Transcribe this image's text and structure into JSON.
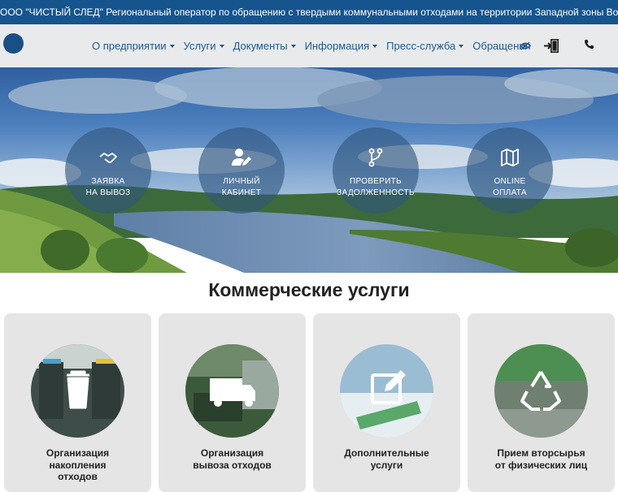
{
  "header": {
    "banner_text": "ООО \"ЧИСТЫЙ СЛЕД\" Региональный оператор по обращению с твердыми коммунальными отходами на территории Западной зоны Вологодской области"
  },
  "nav": {
    "items": [
      {
        "label": "О предприятии",
        "dropdown": true
      },
      {
        "label": "Услуги",
        "dropdown": true
      },
      {
        "label": "Документы",
        "dropdown": true
      },
      {
        "label": "Информация",
        "dropdown": true
      },
      {
        "label": "Пресс-служба",
        "dropdown": true
      },
      {
        "label": "Обращения",
        "dropdown": false
      }
    ],
    "icons": [
      "eye-icon",
      "login-icon",
      "phone-icon"
    ]
  },
  "hero": {
    "buttons": [
      {
        "line1": "ЗАЯВКА",
        "line2": "НА ВЫВОЗ",
        "icon": "handshake-icon"
      },
      {
        "line1": "ЛИЧНЫЙ",
        "line2": "КАБИНЕТ",
        "icon": "user-edit-icon"
      },
      {
        "line1": "ПРОВЕРИТЬ",
        "line2": "ЗАДОЛЖЕННОСТЬ",
        "icon": "branch-icon"
      },
      {
        "line1": "ONLINE",
        "line2": "ОПЛАТА",
        "icon": "map-icon"
      }
    ]
  },
  "section": {
    "title": "Коммерческие услуги"
  },
  "cards": [
    {
      "lines": [
        "Организация",
        "накопления",
        "отходов"
      ],
      "icon": "trash-icon"
    },
    {
      "lines": [
        "Организация",
        "вывоза отходов"
      ],
      "icon": "truck-icon"
    },
    {
      "lines": [
        "Дополнительные",
        "услуги"
      ],
      "icon": "edit-icon"
    },
    {
      "lines": [
        "Прием вторсырья",
        "от физических лиц"
      ],
      "icon": "recycle-icon"
    }
  ],
  "colors": {
    "banner": "#16548d",
    "nav_text": "#1f5a8e",
    "card_bg": "#e5e5e5"
  }
}
